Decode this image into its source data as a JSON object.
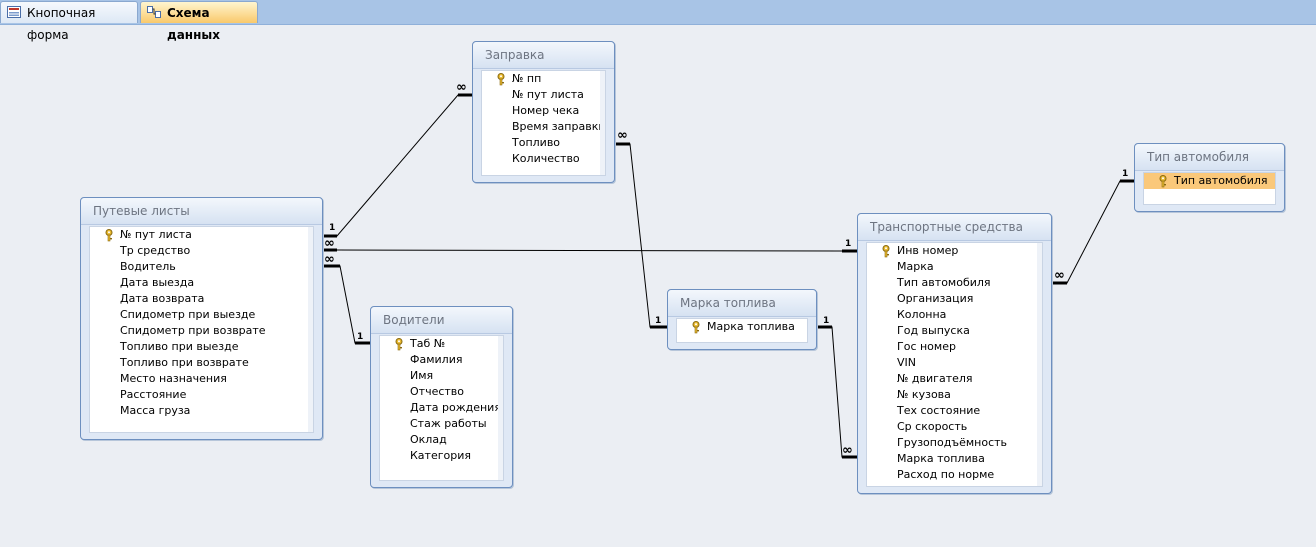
{
  "tabs": [
    {
      "label": "Кнопочная форма",
      "icon": "form-icon"
    },
    {
      "label": "Схема данных",
      "icon": "relationships-icon",
      "active": true
    }
  ],
  "tables": {
    "zapravka": {
      "title": "Заправка",
      "fields": [
        "№ пп",
        "№ пут листа",
        "Номер чека",
        "Время заправки",
        "Топливо",
        "Количество"
      ],
      "key": 0
    },
    "putevye": {
      "title": "Путевые листы",
      "fields": [
        "№ пут листа",
        "Тр средство",
        "Водитель",
        "Дата выезда",
        "Дата возврата",
        "Спидометр при выезде",
        "Спидометр при возврате",
        "Топливо при выезде",
        "Топливо при возврате",
        "Место назначения",
        "Расстояние",
        "Масса груза"
      ],
      "key": 0
    },
    "voditeli": {
      "title": "Водители",
      "fields": [
        "Таб №",
        "Фамилия",
        "Имя",
        "Отчество",
        "Дата рождения",
        "Стаж работы",
        "Оклад",
        "Категория"
      ],
      "key": 0
    },
    "marka": {
      "title": "Марка топлива",
      "fields": [
        "Марка топлива"
      ],
      "key": 0
    },
    "transport": {
      "title": "Транспортные средства",
      "fields": [
        "Инв номер",
        "Марка",
        "Тип автомобиля",
        "Организация",
        "Колонна",
        "Год выпуска",
        "Гос номер",
        "VIN",
        "№ двигателя",
        "№ кузова",
        "Тех состояние",
        "Ср скорость",
        "Грузоподъёмность",
        "Марка топлива",
        "Расход по норме"
      ],
      "key": 0
    },
    "tip": {
      "title": "Тип автомобиля",
      "fields": [
        "Тип автомобиля"
      ],
      "key": 0,
      "selected": 0
    }
  },
  "cardinality": {
    "one": "1",
    "many": "∞"
  },
  "colors": {
    "selected_row": "#fac87a",
    "canvas": "#ebeef3",
    "tab_active": "#f9c96b"
  }
}
